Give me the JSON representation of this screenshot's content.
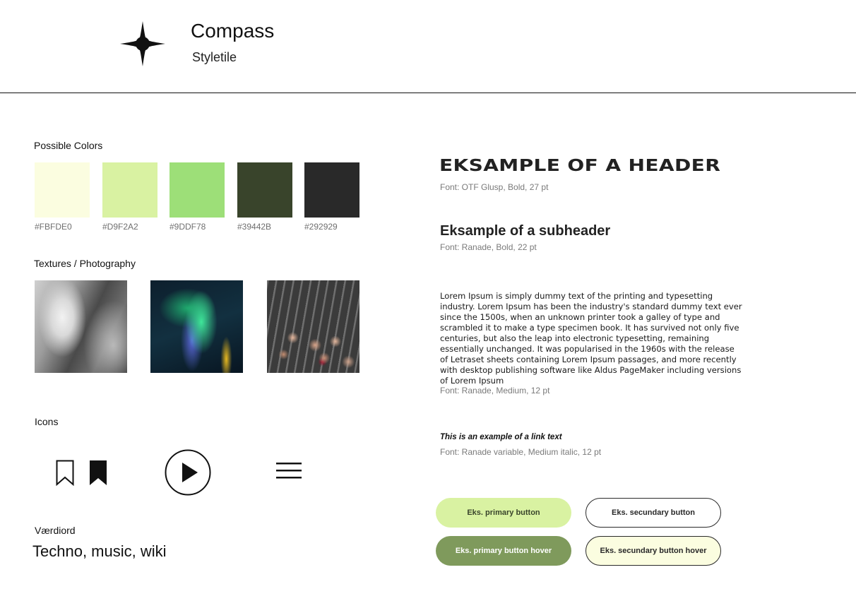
{
  "header": {
    "title": "Compass",
    "subtitle": "Styletile",
    "logo_icon": "four-point-star-icon"
  },
  "colors": {
    "label": "Possible Colors",
    "swatches": [
      {
        "hex": "#FBFDE0",
        "label": "#FBFDE0"
      },
      {
        "hex": "#D9F2A2",
        "label": "#D9F2A2"
      },
      {
        "hex": "#9DDF78",
        "label": "#9DDF78"
      },
      {
        "hex": "#39442B",
        "label": "#39442B"
      },
      {
        "hex": "#292929",
        "label": "#292929"
      }
    ]
  },
  "textures": {
    "label": "Textures / Photography"
  },
  "icons": {
    "label": "Icons",
    "items": [
      "bookmark-outline-icon",
      "bookmark-filled-icon",
      "play-circle-icon",
      "hamburger-menu-icon"
    ]
  },
  "values": {
    "label": "Værdiord",
    "text": "Techno, music, wiki"
  },
  "typography": {
    "header_sample": "EKSAMPLE OF A HEADER",
    "header_font": "Font: OTF Glusp, Bold, 27 pt",
    "subheader_sample": "Eksample of a subheader",
    "subheader_font": "Font: Ranade, Bold, 22 pt",
    "body_sample": "Lorem Ipsum  is simply dummy text of the printing and typesetting industry. Lorem Ipsum has been the industry's standard dummy text ever since the 1500s, when an unknown printer took a galley of type and scrambled it to make a type specimen book. It has survived not only five centuries, but also the leap into electronic typesetting, remaining essentially unchanged. It was popularised in the 1960s with the release of Letraset sheets containing Lorem Ipsum passages, and more recently with desktop publishing software like Aldus PageMaker including versions of Lorem Ipsum",
    "body_font": "Font: Ranade, Medium, 12 pt",
    "link_sample": "This is an example of a link text",
    "link_font": "Font: Ranade variable, Medium italic, 12 pt"
  },
  "buttons": {
    "primary": "Eks. primary button",
    "secondary": "Eks. secundary  button",
    "primary_hover": "Eks. primary button hover",
    "secondary_hover": "Eks. secundary button hover"
  }
}
